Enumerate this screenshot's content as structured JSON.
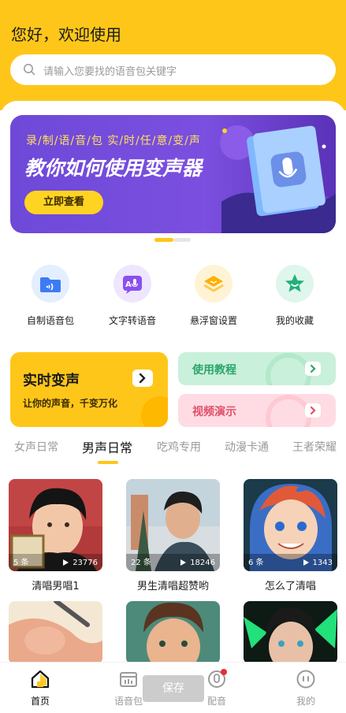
{
  "header": {
    "greeting": "您好，欢迎使用",
    "search_placeholder": "请输入您要找的语音包关键字"
  },
  "banner": {
    "subtitle": "录/制/语/音/包   实/时/任/意/变/声",
    "title": "教你如何使用变声器",
    "button_label": "立即查看"
  },
  "features": [
    {
      "label": "自制语音包",
      "icon": "folder-audio-icon"
    },
    {
      "label": "文字转语音",
      "icon": "text-to-speech-icon"
    },
    {
      "label": "悬浮窗设置",
      "icon": "layers-icon"
    },
    {
      "label": "我的收藏",
      "icon": "star-icon"
    }
  ],
  "cards": {
    "realtime": {
      "title": "实时变声",
      "subtitle": "让你的声音，千变万化"
    },
    "tutorial": {
      "title": "使用教程"
    },
    "demo": {
      "title": "视频演示"
    }
  },
  "category_tabs": [
    "女声日常",
    "男声日常",
    "吃鸡专用",
    "动漫卡通",
    "王者荣耀"
  ],
  "active_tab": "男声日常",
  "items": [
    {
      "title": "清唱男唱1",
      "count": "5 条",
      "plays": "23776"
    },
    {
      "title": "男生清唱超赞哟",
      "count": "22 条",
      "plays": "18246"
    },
    {
      "title": "怎么了清唱",
      "count": "6 条",
      "plays": "1343"
    }
  ],
  "bottom_nav": [
    {
      "label": "首页",
      "icon": "home-icon",
      "active": true
    },
    {
      "label": "语音包",
      "icon": "voice-pack-icon",
      "active": false
    },
    {
      "label": "配音",
      "icon": "microphone-icon",
      "active": false
    },
    {
      "label": "我的",
      "icon": "profile-icon",
      "active": false
    }
  ],
  "save_overlay_label": "保存",
  "colors": {
    "accent": "#FFC61A",
    "banner_purple": "#7B4FDF",
    "tutorial_green": "#2EA56B",
    "demo_red": "#E0506A"
  }
}
